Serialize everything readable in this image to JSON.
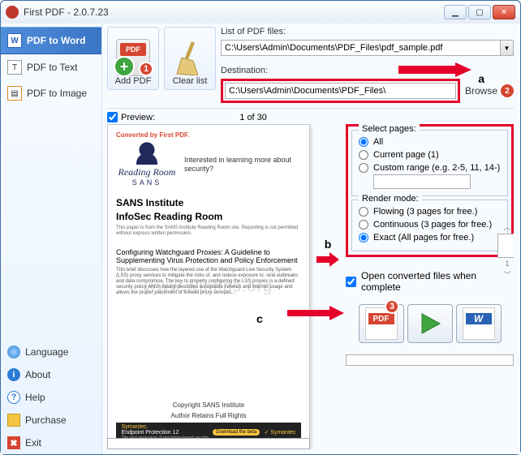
{
  "window": {
    "title": "First PDF - 2.0.7.23"
  },
  "winbtns": {
    "min": "▁",
    "max": "▢",
    "close": "✕"
  },
  "sidebar": {
    "top": [
      {
        "label": "PDF to Word"
      },
      {
        "label": "PDF to Text"
      },
      {
        "label": "PDF to Image"
      }
    ],
    "bottom": [
      {
        "label": "Language"
      },
      {
        "label": "About"
      },
      {
        "label": "Help"
      },
      {
        "label": "Purchase"
      },
      {
        "label": "Exit"
      }
    ]
  },
  "toolbar": {
    "add_pdf": "Add PDF",
    "clear_list": "Clear list",
    "badge1": "1"
  },
  "files": {
    "list_label": "List of PDF files:",
    "list_value": "C:\\Users\\Admin\\Documents\\PDF_Files\\pdf_sample.pdf",
    "dest_label": "Destination:",
    "dest_value": "C:\\Users\\Admin\\Documents\\PDF_Files\\",
    "browse": "Browse",
    "badge2": "2"
  },
  "preview": {
    "checkbox_label": "Preview:",
    "page_of": "1 of 30",
    "converted_by": "Converted by First PDF.",
    "rr_title": "Reading Room",
    "rr_sub": "SANS",
    "rr_tag": "Interested in learning more about security?",
    "doc_h1a": "SANS Institute",
    "doc_h1b": "InfoSec Reading Room",
    "doc_tiny": "This paper is from the SANS Institute Reading Room site. Reposting is not permitted without express written permission.",
    "doc_h2": "Configuring Watchguard Proxies: A Guideline to Supplementing Virus Protection and Policy Enforcement",
    "doc_para": "This brief discusses how the layered use of the Watchguard Live Security System (LSS) proxy services to mitigate the risks of, and reduce exposure to, viral outbreaks and data compromise. The key to properly configuring the LSS proxies is a defined security policy which clearly describes acceptable network and internet usage and allows the proper placement of firewall proxy services...",
    "copyright1": "Copyright SANS Institute",
    "copyright2": "Author Retains Full Rights",
    "sym_brand": "Symantec.",
    "sym_prod": "Endpoint Protection 12",
    "sym_tag": "The next generation of reputation-based security",
    "sym_dl": "Download the beta",
    "sym_right": "✓ Symantec"
  },
  "watermark": "www.wintips.org",
  "select_pages": {
    "legend": "Select pages:",
    "all": "All",
    "current": "Current page (1)",
    "custom": "Custom range (e.g. 2-5, 11, 14-)",
    "range_value": ""
  },
  "render_mode": {
    "legend": "Render mode:",
    "flowing": "Flowing (3 pages for free.)",
    "continuous": "Continuous (3 pages for free.)",
    "exact": "Exact (All pages for free.)"
  },
  "thumb_nav": {
    "page": "1"
  },
  "open_complete": "Open converted files when complete",
  "convert": {
    "badge3": "3"
  },
  "annotations": {
    "a": "a",
    "b": "b",
    "c": "c"
  }
}
